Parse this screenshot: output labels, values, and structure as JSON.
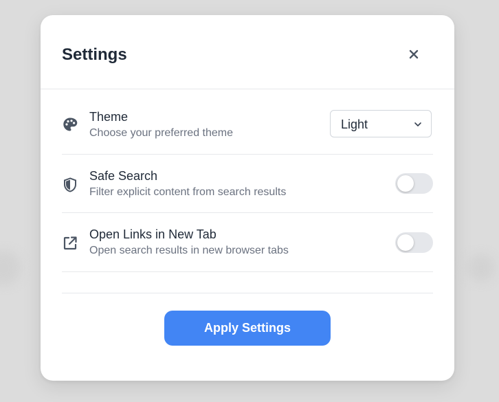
{
  "modal": {
    "title": "Settings",
    "close_icon": "close-icon"
  },
  "settings": [
    {
      "label": "Theme",
      "description": "Choose your preferred theme",
      "icon": "palette-icon",
      "control": "select",
      "value": "Light"
    },
    {
      "label": "Safe Search",
      "description": "Filter explicit content from search results",
      "icon": "shield-icon",
      "control": "toggle",
      "enabled": false
    },
    {
      "label": "Open Links in New Tab",
      "description": "Open search results in new browser tabs",
      "icon": "external-link-icon",
      "control": "toggle",
      "enabled": false
    }
  ],
  "footer": {
    "apply_label": "Apply Settings"
  },
  "colors": {
    "accent": "#4285f4",
    "text_primary": "#1f2937",
    "text_secondary": "#6b7280",
    "toggle_off": "#e5e7eb",
    "divider": "#e6e8eb"
  }
}
